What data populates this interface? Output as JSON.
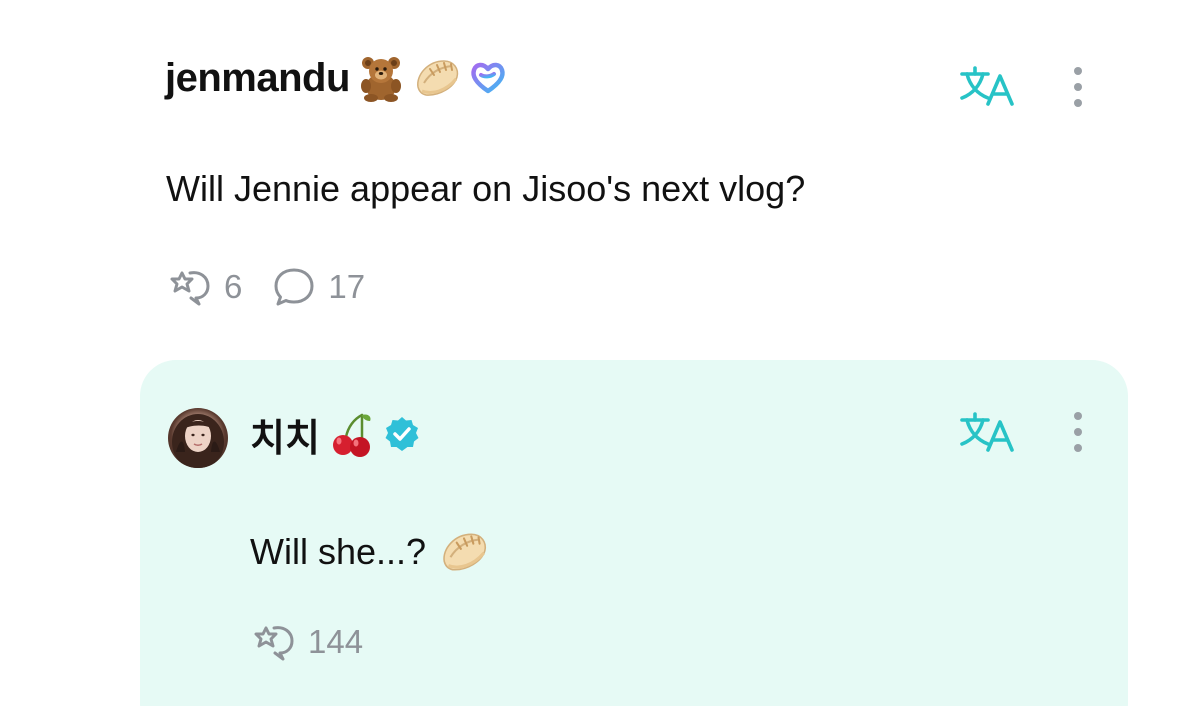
{
  "post": {
    "username": "jenmandu",
    "badges": [
      "teddy-bear-emoji",
      "dumpling-emoji",
      "heart-gradient-badge"
    ],
    "text": "Will Jennie appear on Jisoo's next vlog?",
    "reactions_count": "6",
    "comments_count": "17"
  },
  "reply": {
    "username": "치치",
    "badges": [
      "cherry-emoji",
      "verified-badge"
    ],
    "text": "Will she...?",
    "text_emoji": "dumpling-emoji",
    "reactions_count": "144"
  },
  "colors": {
    "translate_accent": "#27c3c6",
    "verified_badge": "#2fc0d8",
    "reply_background": "#e6faf5",
    "meta_gray": "#8e9298"
  }
}
